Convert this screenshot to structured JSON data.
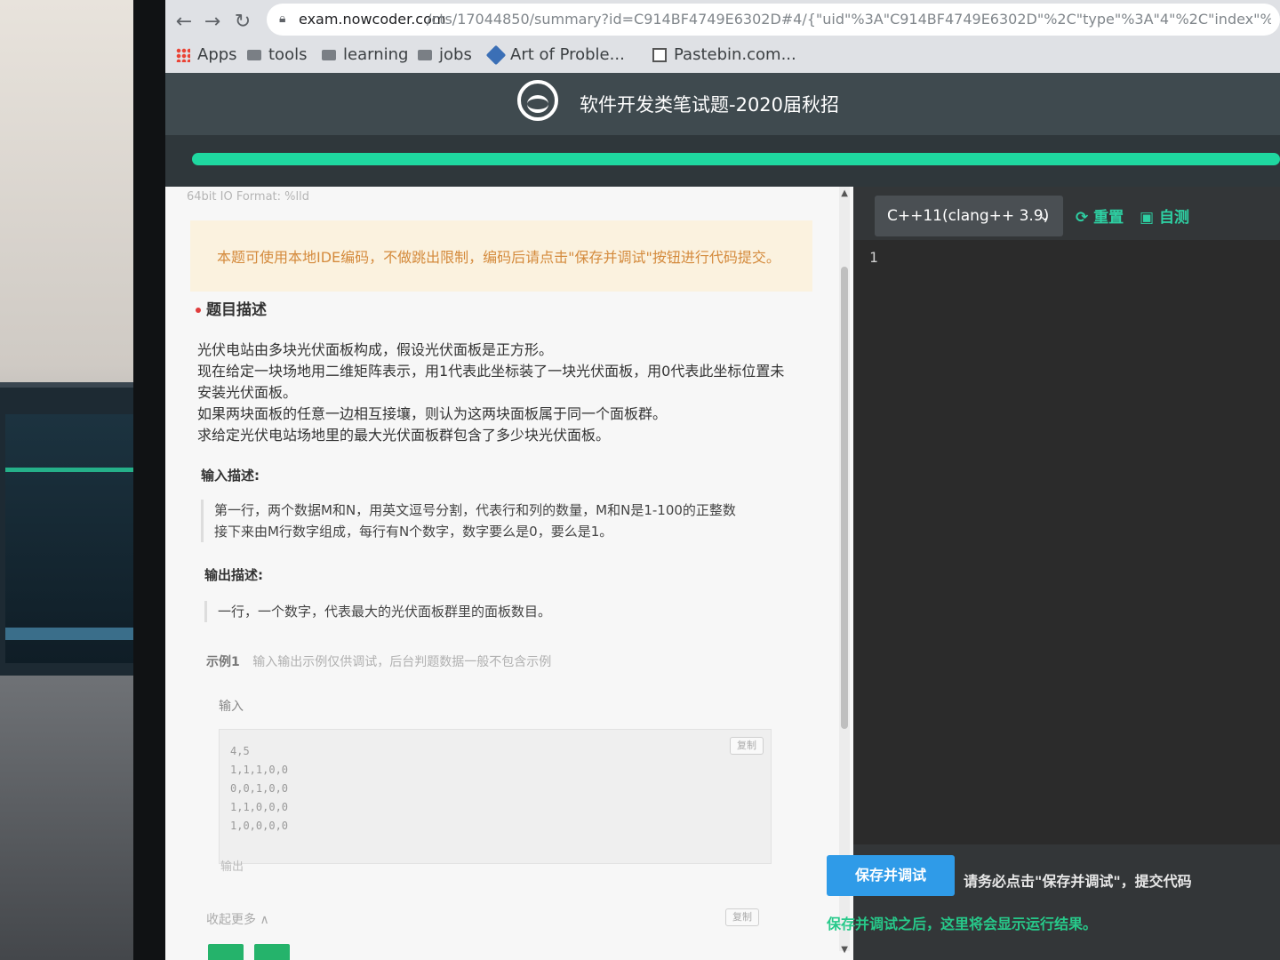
{
  "browser": {
    "url_host": "exam.nowcoder.com",
    "url_path": "/cts/17044850/summary?id=C914BF4749E6302D#4/{\"uid\"%3A\"C914BF4749E6302D\"%2C\"type\"%3A\"4\"%2C\"index\"%",
    "bookmarks": [
      "Apps",
      "tools",
      "learning",
      "jobs",
      "Art of Proble...",
      "Pastebin.com..."
    ]
  },
  "header": {
    "title": "软件开发类笔试题-2020届秋招",
    "progress_fraction": 1.0,
    "progress_color": "#1fd8a0"
  },
  "problem": {
    "io_format": "64bit IO Format: %lld",
    "notice": "本题可使用本地IDE编码，不做跳出限制，编码后请点击\"保存并调试\"按钮进行代码提交。",
    "desc_title": "题目描述",
    "desc_lines": [
      "光伏电站由多块光伏面板构成，假设光伏面板是正方形。",
      "现在给定一块场地用二维矩阵表示，用1代表此坐标装了一块光伏面板，用0代表此坐标位置未",
      "安装光伏面板。",
      "如果两块面板的任意一边相互接壤，则认为这两块面板属于同一个面板群。",
      "求给定光伏电站场地里的最大光伏面板群包含了多少块光伏面板。"
    ],
    "input_title": "输入描述:",
    "input_lines": [
      "第一行，两个数据M和N，用英文逗号分割，代表行和列的数量，M和N是1-100的正整数",
      "接下来由M行数字组成，每行有N个数字，数字要么是0，要么是1。"
    ],
    "output_title": "输出描述:",
    "output_line": "一行，一个数字，代表最大的光伏面板群里的面板数目。",
    "sample_label": "示例1",
    "sample_hint": "输入输出示例仅供调试，后台判题数据一般不包含示例",
    "input_label": "输入",
    "sample_input": [
      "4,5",
      "1,1,1,0,0",
      "0,0,1,0,0",
      "1,1,0,0,0",
      "1,0,0,0,0"
    ],
    "copy_label": "复制",
    "output_label": "输出",
    "fold_text": "收起更多 ∧"
  },
  "editor": {
    "language": "C++11(clang++ 3.9)",
    "reset_label": "重置",
    "selftest_label": "自测",
    "line_number": "1",
    "save_button": "保存并调试",
    "save_hint": "请务必点击\"保存并调试\"，提交代码",
    "result_hint": "保存并调试之后，这里将会显示运行结果。"
  },
  "colors": {
    "accent_green": "#1fd8a0",
    "button_blue": "#2f9be8",
    "header_bg": "#3f4a4f"
  },
  "icons": [
    "back-icon",
    "forward-icon",
    "reload-icon",
    "lock-icon",
    "apps-icon",
    "folder-icon",
    "aops-icon",
    "pastebin-icon",
    "nowcoder-logo-icon",
    "reset-icon",
    "selftest-icon",
    "chevron-down-icon"
  ]
}
